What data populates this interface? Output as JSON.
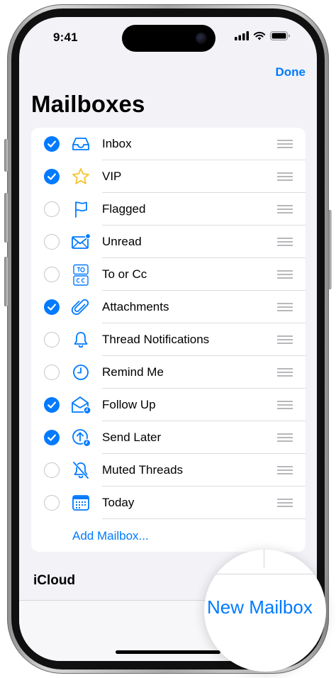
{
  "status": {
    "time": "9:41",
    "icons": [
      "cellular-signal-icon",
      "wifi-icon",
      "battery-icon"
    ]
  },
  "nav": {
    "done_label": "Done",
    "title": "Mailboxes"
  },
  "mailboxes": [
    {
      "label": "Inbox",
      "checked": true,
      "icon": "inbox-tray-icon"
    },
    {
      "label": "VIP",
      "checked": true,
      "icon": "star-icon"
    },
    {
      "label": "Flagged",
      "checked": false,
      "icon": "flag-icon"
    },
    {
      "label": "Unread",
      "checked": false,
      "icon": "unread-envelope-icon"
    },
    {
      "label": "To or Cc",
      "checked": false,
      "icon": "to-cc-icon"
    },
    {
      "label": "Attachments",
      "checked": true,
      "icon": "paperclip-icon"
    },
    {
      "label": "Thread Notifications",
      "checked": false,
      "icon": "bell-icon"
    },
    {
      "label": "Remind Me",
      "checked": false,
      "icon": "clock-icon"
    },
    {
      "label": "Follow Up",
      "checked": true,
      "icon": "follow-up-envelope-icon"
    },
    {
      "label": "Send Later",
      "checked": true,
      "icon": "send-later-icon"
    },
    {
      "label": "Muted Threads",
      "checked": false,
      "icon": "muted-bell-icon"
    },
    {
      "label": "Today",
      "checked": false,
      "icon": "calendar-icon"
    }
  ],
  "add_mailbox_label": "Add Mailbox...",
  "sections": {
    "icloud_label": "iCloud"
  },
  "toolbar": {
    "new_mailbox_label": "New Mailbox"
  },
  "colors": {
    "accent": "#007aff",
    "background": "#f2f2f7",
    "card": "#ffffff"
  }
}
